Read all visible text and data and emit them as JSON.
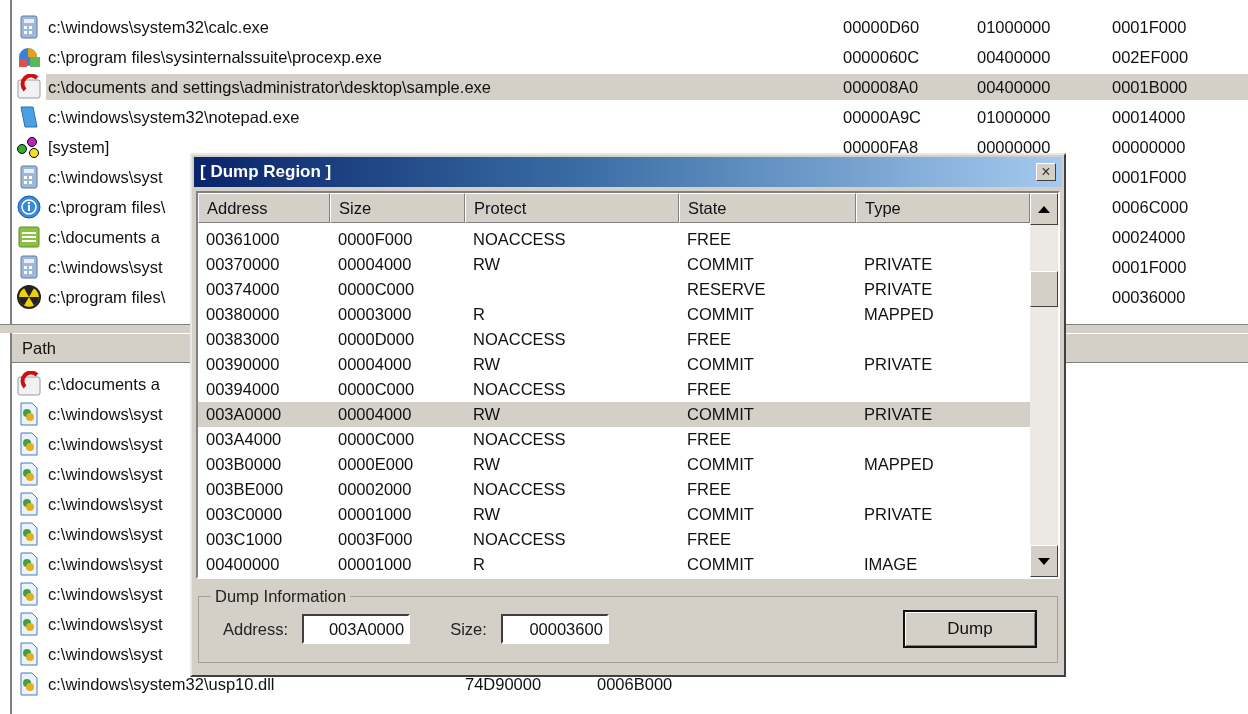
{
  "process_list": {
    "rows": [
      {
        "kind": "calculator",
        "path": "c:\\windows\\system32\\calc.exe",
        "column_2": "00000D60",
        "column_3": "01000000",
        "column_4": "0001F000",
        "selected": false
      },
      {
        "kind": "app",
        "path": "c:\\program files\\sysinternalssuite\\procexp.exe",
        "column_2": "0000060C",
        "column_3": "00400000",
        "column_4": "002EF000",
        "selected": false
      },
      {
        "kind": "sample",
        "path": "c:\\documents and settings\\administrator\\desktop\\sample.exe",
        "column_2": "000008A0",
        "column_3": "00400000",
        "column_4": "0001B000",
        "selected": true
      },
      {
        "kind": "notepad",
        "path": "c:\\windows\\system32\\notepad.exe",
        "column_2": "00000A9C",
        "column_3": "01000000",
        "column_4": "00014000",
        "selected": false
      },
      {
        "kind": "system",
        "path": "[system]",
        "column_2": "00000FA8",
        "column_3": "00000000",
        "column_4": "00000000",
        "selected": false
      },
      {
        "kind": "calculator",
        "path": "c:\\windows\\syst",
        "column_4": "0001F000",
        "selected": false
      },
      {
        "kind": "info",
        "path": "c:\\program files\\",
        "column_4": "0006C000",
        "selected": false
      },
      {
        "kind": "list",
        "path": "c:\\documents a",
        "column_4": "00024000",
        "selected": false
      },
      {
        "kind": "calculator",
        "path": "c:\\windows\\syst",
        "column_4": "0001F000",
        "selected": false
      },
      {
        "kind": "radiation",
        "path": "c:\\program files\\",
        "column_4": "00036000",
        "selected": false
      }
    ]
  },
  "module_list": {
    "columns": [
      "Path"
    ],
    "rows": [
      {
        "kind": "sample",
        "path": "c:\\documents a"
      },
      {
        "kind": "dll",
        "path": "c:\\windows\\syst"
      },
      {
        "kind": "dll",
        "path": "c:\\windows\\syst"
      },
      {
        "kind": "dll",
        "path": "c:\\windows\\syst"
      },
      {
        "kind": "dll",
        "path": "c:\\windows\\syst"
      },
      {
        "kind": "dll",
        "path": "c:\\windows\\syst"
      },
      {
        "kind": "dll",
        "path": "c:\\windows\\syst"
      },
      {
        "kind": "dll",
        "path": "c:\\windows\\syst"
      },
      {
        "kind": "dll",
        "path": "c:\\windows\\syst"
      },
      {
        "kind": "dll",
        "path": "c:\\windows\\syst"
      },
      {
        "kind": "dll",
        "path": "c:\\windows\\system32\\usp10.dll",
        "column_2": "74D90000",
        "column_3": "0006B000"
      }
    ]
  },
  "dialog": {
    "title": "[ Dump Region ]",
    "close": "×",
    "table": {
      "columns": [
        "Address",
        "Size",
        "Protect",
        "State",
        "Type"
      ],
      "rows": [
        {
          "address": "00361000",
          "size": "0000F000",
          "protect": "NOACCESS",
          "state": "FREE",
          "selected": false
        },
        {
          "address": "00370000",
          "size": "00004000",
          "protect": "RW",
          "state": "COMMIT",
          "type": "PRIVATE",
          "selected": false
        },
        {
          "address": "00374000",
          "size": "0000C000",
          "state": "RESERVE",
          "type": "PRIVATE",
          "selected": false
        },
        {
          "address": "00380000",
          "size": "00003000",
          "protect": "R",
          "state": "COMMIT",
          "type": "MAPPED",
          "selected": false
        },
        {
          "address": "00383000",
          "size": "0000D000",
          "protect": "NOACCESS",
          "state": "FREE",
          "selected": false
        },
        {
          "address": "00390000",
          "size": "00004000",
          "protect": "RW",
          "state": "COMMIT",
          "type": "PRIVATE",
          "selected": false
        },
        {
          "address": "00394000",
          "size": "0000C000",
          "protect": "NOACCESS",
          "state": "FREE",
          "selected": false
        },
        {
          "address": "003A0000",
          "size": "00004000",
          "protect": "RW",
          "state": "COMMIT",
          "type": "PRIVATE",
          "selected": true
        },
        {
          "address": "003A4000",
          "size": "0000C000",
          "protect": "NOACCESS",
          "state": "FREE",
          "selected": false
        },
        {
          "address": "003B0000",
          "size": "0000E000",
          "protect": "RW",
          "state": "COMMIT",
          "type": "MAPPED",
          "selected": false
        },
        {
          "address": "003BE000",
          "size": "00002000",
          "protect": "NOACCESS",
          "state": "FREE",
          "selected": false
        },
        {
          "address": "003C0000",
          "size": "00001000",
          "protect": "RW",
          "state": "COMMIT",
          "type": "PRIVATE",
          "selected": false
        },
        {
          "address": "003C1000",
          "size": "0003F000",
          "protect": "NOACCESS",
          "state": "FREE",
          "selected": false
        },
        {
          "address": "00400000",
          "size": "00001000",
          "protect": "R",
          "state": "COMMIT",
          "type": "IMAGE",
          "selected": false
        }
      ]
    },
    "group": {
      "title": "Dump Information",
      "address_label": "Address:",
      "address_value": "003A0000",
      "size_label": "Size:",
      "size_value": "00003600",
      "button": "Dump"
    }
  }
}
